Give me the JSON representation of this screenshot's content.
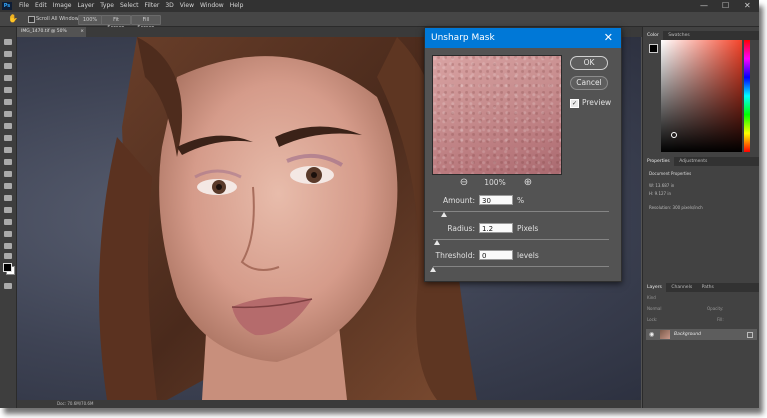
{
  "menubar": {
    "app_logo": "Ps",
    "items": [
      "File",
      "Edit",
      "Image",
      "Layer",
      "Type",
      "Select",
      "Filter",
      "3D",
      "View",
      "Window",
      "Help"
    ],
    "minimize": "—",
    "maximize": "☐",
    "close": "✕"
  },
  "options_bar": {
    "scroll_all_windows": "Scroll All Windows",
    "zoom_100": "100%",
    "fit_screen": "Fit Screen",
    "fill_screen": "Fill Screen"
  },
  "document": {
    "tab_title": "IMG_1470.tif @ 50% (RGB/8*)",
    "tab_close": "×",
    "status": "Doc: 70.6M/70.6M"
  },
  "panels": {
    "color_tabs": [
      "Color",
      "Swatches"
    ],
    "properties_tabs": [
      "Properties",
      "Adjustments"
    ],
    "doc_props_label": "Document Properties",
    "width_label": "W: 13.687 in",
    "height_label": "H: 9.127 in",
    "resolution_label": "Resolution: 300 pixels/inch",
    "layers_tabs": [
      "Layers",
      "Channels",
      "Paths"
    ],
    "kind_label": "Kind",
    "normal_label": "Normal",
    "opacity_label": "Opacity:",
    "lock_label": "Lock:",
    "fill_label": "Fill:",
    "layer_name": "Background",
    "layer_eye": "◉"
  },
  "dialog": {
    "title": "Unsharp Mask",
    "close_icon": "✕",
    "zoom_out": "⊖",
    "zoom_in": "⊕",
    "zoom_level": "100%",
    "ok_label": "OK",
    "cancel_label": "Cancel",
    "preview_label": "Preview",
    "preview_checked": true,
    "amount": {
      "label": "Amount:",
      "value": "30",
      "unit": "%",
      "slider_fraction": 0.06
    },
    "radius": {
      "label": "Radius:",
      "value": "1.2",
      "unit": "Pixels",
      "slider_fraction": 0.02
    },
    "threshold": {
      "label": "Threshold:",
      "value": "0",
      "unit": "levels",
      "slider_fraction": 0.0
    }
  }
}
